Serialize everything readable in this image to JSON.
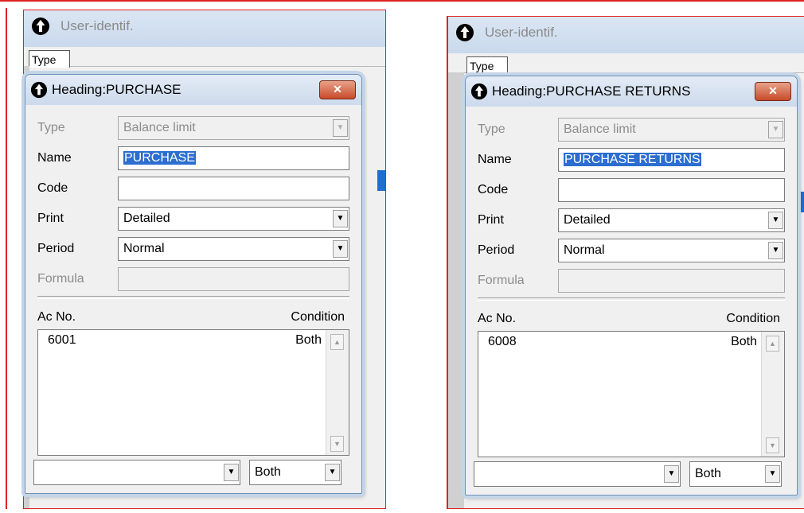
{
  "left": {
    "bg_window": {
      "title": "User-identif.",
      "tab_label": "Type"
    },
    "dialog": {
      "title": "Heading:PURCHASE",
      "close_label": "✕",
      "fields": {
        "type_label": "Type",
        "type_value": "Balance limit",
        "name_label": "Name",
        "name_value": "PURCHASE",
        "code_label": "Code",
        "code_value": "",
        "print_label": "Print",
        "print_value": "Detailed",
        "period_label": "Period",
        "period_value": "Normal",
        "formula_label": "Formula",
        "formula_value": ""
      },
      "list": {
        "col_acno": "Ac No.",
        "col_condition": "Condition",
        "rows": [
          {
            "acno": "6001",
            "condition": "Both"
          }
        ]
      },
      "bottom": {
        "acno_value": "",
        "condition_value": "Both"
      }
    }
  },
  "right": {
    "bg_window": {
      "title": "User-identif.",
      "tab_label": "Type"
    },
    "dialog": {
      "title": "Heading:PURCHASE RETURNS",
      "close_label": "✕",
      "fields": {
        "type_label": "Type",
        "type_value": "Balance limit",
        "name_label": "Name",
        "name_value": "PURCHASE RETURNS",
        "code_label": "Code",
        "code_value": "",
        "print_label": "Print",
        "print_value": "Detailed",
        "period_label": "Period",
        "period_value": "Normal",
        "formula_label": "Formula",
        "formula_value": ""
      },
      "list": {
        "col_acno": "Ac No.",
        "col_condition": "Condition",
        "rows": [
          {
            "acno": "6008",
            "condition": "Both"
          }
        ]
      },
      "bottom": {
        "acno_value": "",
        "condition_value": "Both"
      }
    }
  },
  "colors": {
    "frame_red": "#e02020",
    "selection_blue": "#2b6dd0",
    "close_red": "#c84a2a",
    "title_gradient": "#ccdaec"
  },
  "icons": {
    "app_icon": "up-arrow-circle-icon",
    "dropdown": "chevron-down-icon",
    "close": "close-icon",
    "scroll_up": "scroll-up-icon",
    "scroll_down": "scroll-down-icon"
  }
}
